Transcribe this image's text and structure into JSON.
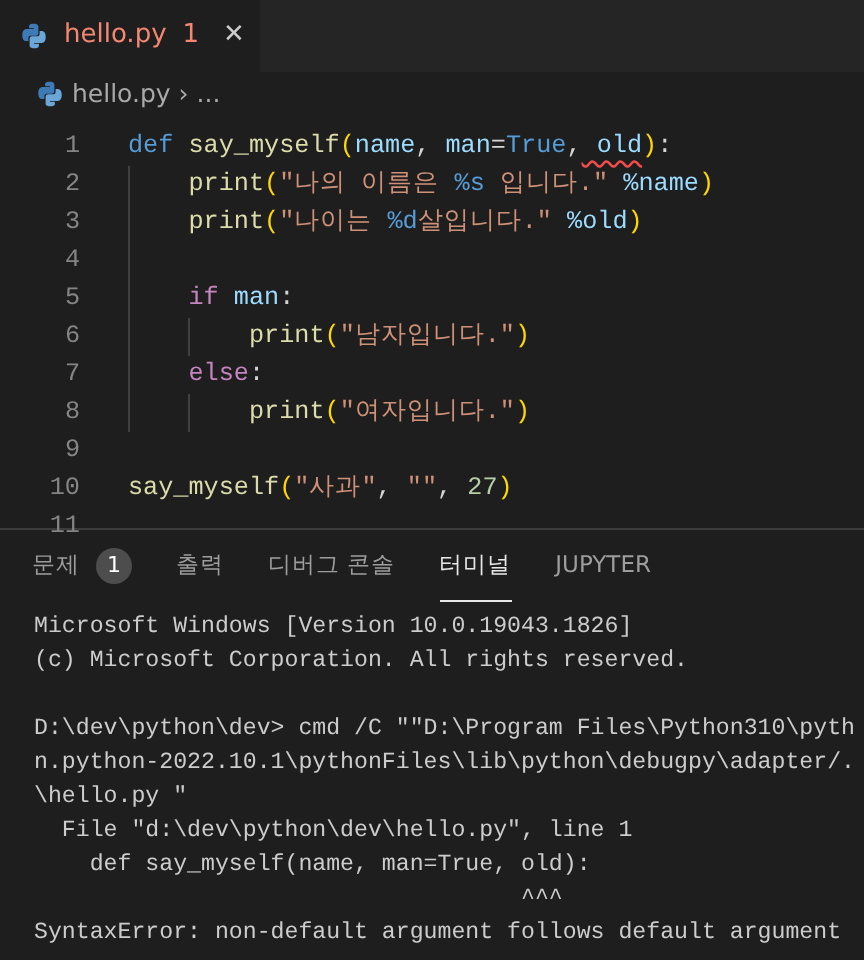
{
  "editor_tabs": [
    {
      "label": "hello.py",
      "problems": "1",
      "close": "✕",
      "selected": true,
      "has_error": true
    }
  ],
  "breadcrumb": {
    "file": "hello.py",
    "separator": "›",
    "more": "..."
  },
  "code_lines": [
    {
      "number": "1",
      "tokens": [
        {
          "kind": "kw",
          "s": "def"
        },
        {
          "kind": "fn",
          "s": " say_myself"
        },
        {
          "kind": "br",
          "s": "("
        },
        {
          "kind": "var",
          "s": "name"
        },
        {
          "kind": "p",
          "s": ","
        },
        {
          "kind": "var",
          "s": " man"
        },
        {
          "kind": "p",
          "s": "="
        },
        {
          "kind": "kw",
          "s": "True"
        },
        {
          "kind": "p",
          "s": ","
        },
        {
          "kind": "err",
          "s": " old"
        },
        {
          "kind": "br",
          "s": ")"
        },
        {
          "kind": "p",
          "s": ":"
        }
      ]
    },
    {
      "number": "2",
      "tokens": [
        {
          "kind": "fn",
          "s": "    print"
        },
        {
          "kind": "br",
          "s": "("
        },
        {
          "kind": "str",
          "s": "\"나의 이름은 "
        },
        {
          "kind": "fmt",
          "s": "%s"
        },
        {
          "kind": "str",
          "s": " 입니다.\""
        },
        {
          "kind": "var",
          "s": " %name"
        },
        {
          "kind": "br",
          "s": ")"
        }
      ]
    },
    {
      "number": "3",
      "tokens": [
        {
          "kind": "fn",
          "s": "    print"
        },
        {
          "kind": "br",
          "s": "("
        },
        {
          "kind": "str",
          "s": "\"나이는 "
        },
        {
          "kind": "fmt",
          "s": "%d"
        },
        {
          "kind": "str",
          "s": "살입니다.\""
        },
        {
          "kind": "var",
          "s": " %old"
        },
        {
          "kind": "br",
          "s": ")"
        }
      ]
    },
    {
      "number": "4",
      "indent_guide": true
    },
    {
      "number": "5",
      "tokens": [
        {
          "kind": "ctl",
          "s": "    if"
        },
        {
          "kind": "var",
          "s": " man"
        },
        {
          "kind": "p",
          "s": ":"
        }
      ]
    },
    {
      "number": "6",
      "tokens": [
        {
          "kind": "fn",
          "s": "        print"
        },
        {
          "kind": "br",
          "s": "("
        },
        {
          "kind": "str",
          "s": "\"남자입니다.\""
        },
        {
          "kind": "br",
          "s": ")"
        }
      ]
    },
    {
      "number": "7",
      "tokens": [
        {
          "kind": "ctl",
          "s": "    else"
        },
        {
          "kind": "p",
          "s": ":"
        }
      ]
    },
    {
      "number": "8",
      "tokens": [
        {
          "kind": "fn",
          "s": "        print"
        },
        {
          "kind": "br",
          "s": "("
        },
        {
          "kind": "str",
          "s": "\"여자입니다.\""
        },
        {
          "kind": "br",
          "s": ")"
        }
      ]
    },
    {
      "number": "9"
    },
    {
      "number": "10",
      "tokens": [
        {
          "kind": "fn",
          "s": "say_myself"
        },
        {
          "kind": "br",
          "s": "("
        },
        {
          "kind": "str",
          "s": "\"사과\""
        },
        {
          "kind": "p",
          "s": ","
        },
        {
          "kind": "str",
          "s": " \"\""
        },
        {
          "kind": "p",
          "s": ","
        },
        {
          "kind": "num",
          "s": " 27"
        },
        {
          "kind": "br",
          "s": ")"
        }
      ]
    },
    {
      "number": "11"
    }
  ],
  "panel_tabs": [
    {
      "label": "문제",
      "count": "1",
      "selected": false
    },
    {
      "label": "출력",
      "selected": false
    },
    {
      "label": "디버그 콘솔",
      "selected": false
    },
    {
      "label": "터미널",
      "selected": true
    },
    {
      "label": "JUPYTER",
      "selected": false
    }
  ],
  "terminal_blocks": [
    [
      "Microsoft Windows [Version 10.0.19043.1826]",
      "(c) Microsoft Corporation. All rights reserved."
    ],
    [
      "D:\\dev\\python\\dev> cmd /C \"\"D:\\Program Files\\Python310\\pyth",
      "n.python-2022.10.1\\pythonFiles\\lib\\python\\debugpy\\adapter/.",
      "\\hello.py \"",
      "  File \"d:\\dev\\python\\dev\\hello.py\", line 1",
      "    def say_myself(name, man=True, old):",
      "                                   ^^^",
      "SyntaxError: non-default argument follows default argument"
    ]
  ]
}
